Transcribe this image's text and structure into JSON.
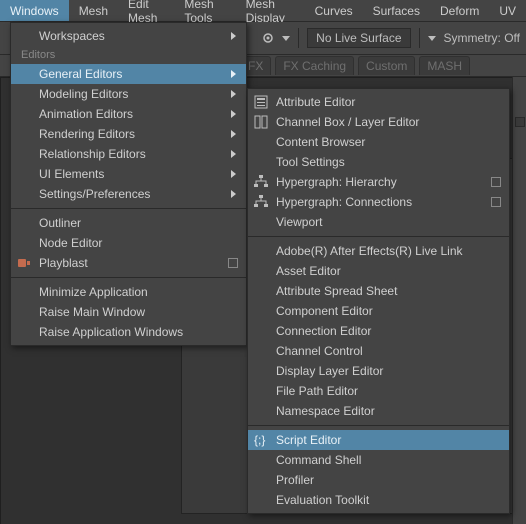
{
  "menubar": {
    "items": [
      "Windows",
      "Mesh",
      "Edit Mesh",
      "Mesh Tools",
      "Mesh Display",
      "Curves",
      "Surfaces",
      "Deform",
      "UV"
    ],
    "active_index": 0
  },
  "toolbar": {
    "live_surface": "No Live Surface",
    "symmetry": "Symmetry: Off"
  },
  "shelf_tabs": [
    "FX",
    "FX Caching",
    "Custom",
    "MASH"
  ],
  "menu1": {
    "group1_header": "Workspaces",
    "group2_header": "Editors",
    "group2_items": [
      {
        "label": "General Editors",
        "arrow": true,
        "highlight": true
      },
      {
        "label": "Modeling Editors",
        "arrow": true
      },
      {
        "label": "Animation Editors",
        "arrow": true
      },
      {
        "label": "Rendering Editors",
        "arrow": true
      },
      {
        "label": "Relationship Editors",
        "arrow": true
      },
      {
        "label": "UI Elements",
        "arrow": true
      },
      {
        "label": "Settings/Preferences",
        "arrow": true
      }
    ],
    "group3_items": [
      {
        "label": "Outliner"
      },
      {
        "label": "Node Editor"
      },
      {
        "label": "Playblast",
        "opt": true,
        "preicon": "playblast"
      }
    ],
    "group4_items": [
      {
        "label": "Minimize Application"
      },
      {
        "label": "Raise Main Window"
      },
      {
        "label": "Raise Application Windows"
      }
    ]
  },
  "menu2": {
    "group1": [
      {
        "label": "Attribute Editor",
        "icon": "attr"
      },
      {
        "label": "Channel Box / Layer Editor",
        "icon": "channelbox"
      },
      {
        "label": "Content Browser"
      },
      {
        "label": "Tool Settings"
      },
      {
        "label": "Hypergraph: Hierarchy",
        "icon": "hyper",
        "opt": true
      },
      {
        "label": "Hypergraph: Connections",
        "icon": "hyper",
        "opt": true
      },
      {
        "label": "Viewport"
      }
    ],
    "group2": [
      {
        "label": "Adobe(R) After Effects(R) Live Link"
      },
      {
        "label": "Asset Editor"
      },
      {
        "label": "Attribute Spread Sheet"
      },
      {
        "label": "Component Editor"
      },
      {
        "label": "Connection Editor"
      },
      {
        "label": "Channel Control"
      },
      {
        "label": "Display Layer Editor"
      },
      {
        "label": "File Path Editor"
      },
      {
        "label": "Namespace Editor"
      }
    ],
    "group3": [
      {
        "label": "Script Editor",
        "icon": "script",
        "highlight": true
      },
      {
        "label": "Command Shell"
      },
      {
        "label": "Profiler"
      },
      {
        "label": "Evaluation Toolkit"
      }
    ]
  }
}
